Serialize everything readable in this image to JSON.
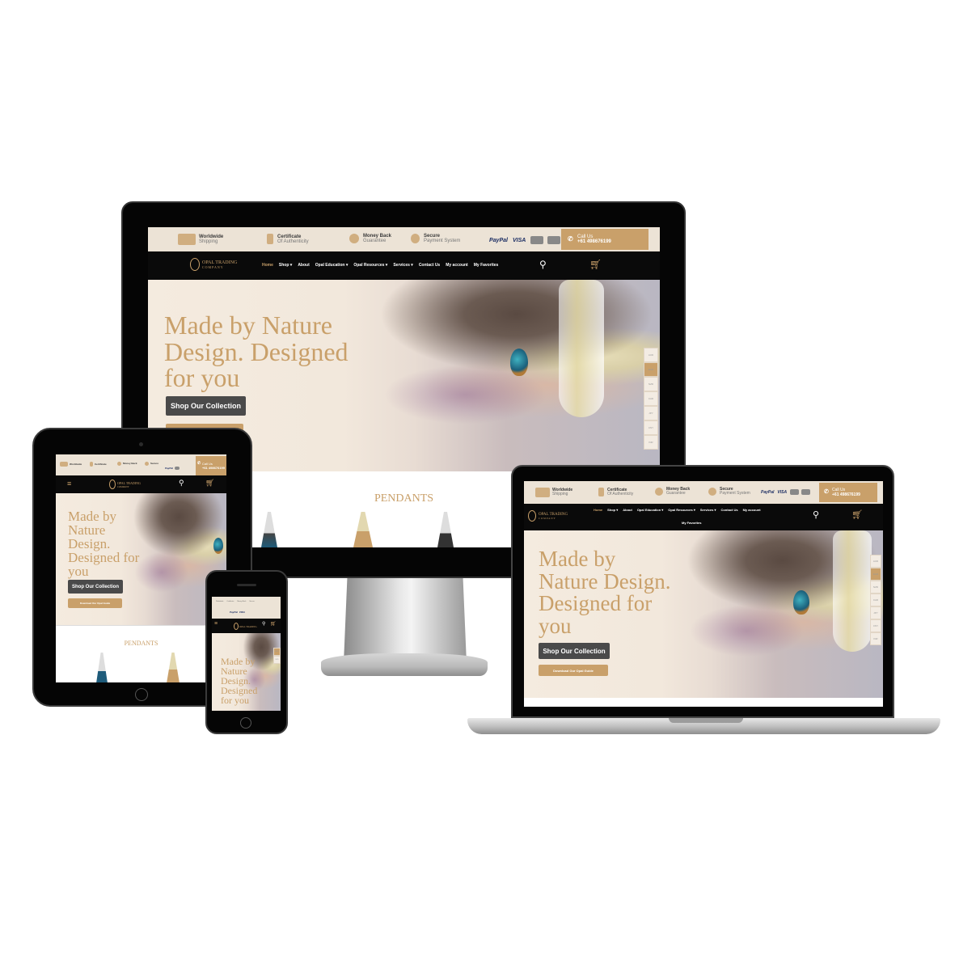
{
  "site": {
    "features": [
      {
        "title": "Worldwide",
        "subtitle": "Shipping",
        "icon": "truck-icon"
      },
      {
        "title": "Certificate",
        "subtitle": "Of Authenticity",
        "icon": "certificate-icon"
      },
      {
        "title": "Money Back",
        "subtitle": "Guarantee",
        "icon": "dollar-icon"
      },
      {
        "title": "Secure",
        "subtitle": "Payment System",
        "icon": "shield-icon"
      }
    ],
    "payments": {
      "paypal": "PayPal",
      "visa": "VISA"
    },
    "call": {
      "label": "Call Us",
      "phone": "+61 498676199"
    },
    "logo": {
      "line1": "OPAL TRADING",
      "line2": "COMPANY"
    },
    "menu": {
      "home": "Home",
      "shop": "Shop",
      "about": "About",
      "education": "Opal Education",
      "resources": "Opal Resources",
      "services": "Services",
      "contact": "Contact Us",
      "account": "My account",
      "favorites": "My Favorites"
    },
    "hero": {
      "monitor_lines": [
        "Made by Nature",
        "Design. Designed",
        "for you"
      ],
      "laptop_lines": [
        "Made by",
        "Nature Design.",
        "Designed for",
        "you"
      ],
      "tablet_lines": [
        "Made by",
        "Nature",
        "Design.",
        "Designed for",
        "you"
      ],
      "phone_lines": [
        "Made by",
        "Nature",
        "Design.",
        "Designed",
        "for you"
      ],
      "shop_button": "Shop Our Collection",
      "guide_button": "Download Our Opal Guide"
    },
    "pendants_heading": "PENDANTS",
    "side_tabs": [
      "AUD",
      "EUR",
      "NZD",
      "CAD",
      "JPY",
      "CNY",
      "INR"
    ]
  },
  "colors": {
    "gold": "#c9a06a",
    "black": "#0a0a0a",
    "cream": "#ece3d6"
  }
}
